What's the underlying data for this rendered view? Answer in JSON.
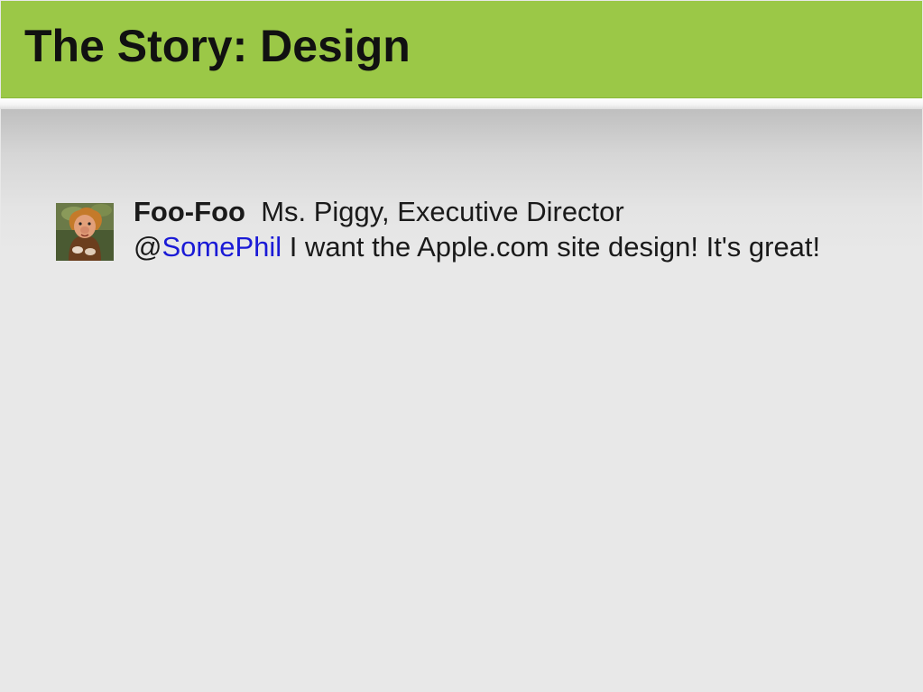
{
  "slide": {
    "title": "The Story: Design"
  },
  "tweet": {
    "author": "Foo-Foo",
    "author_description": "Ms. Piggy, Executive Director",
    "at_sign": "@",
    "mention": "SomePhil",
    "message": "I want the Apple.com site design! It's great!",
    "avatar_icon": "piggy-portrait-avatar"
  },
  "colors": {
    "title_bar": "#9bc847",
    "mention_link": "#1a1ad6",
    "text": "#1a1a1a"
  }
}
